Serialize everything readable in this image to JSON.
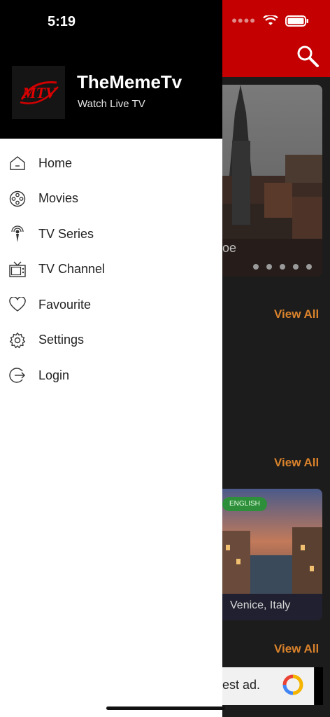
{
  "status_bar": {
    "time": "5:19"
  },
  "drawer": {
    "logo_text": "MTV",
    "app_name": "TheMemeTv",
    "app_subtitle": "Watch Live TV",
    "menu": [
      {
        "label": "Home",
        "icon": "home-icon"
      },
      {
        "label": "Movies",
        "icon": "film-reel-icon"
      },
      {
        "label": "TV Series",
        "icon": "broadcast-icon"
      },
      {
        "label": "TV Channel",
        "icon": "tv-icon"
      },
      {
        "label": "Favourite",
        "icon": "heart-icon"
      },
      {
        "label": "Settings",
        "icon": "gear-icon"
      },
      {
        "label": "Login",
        "icon": "login-icon"
      }
    ]
  },
  "background": {
    "hero_caption_fragment": "oe",
    "view_all": "View All",
    "featured_language": "ENGLISH",
    "featured_caption": "Venice, Italy",
    "ad_text_fragment": "est ad."
  },
  "colors": {
    "brand_red": "#c40000",
    "accent_orange": "#d9822b",
    "drawer_header": "#000000",
    "drawer_body": "#ffffff"
  }
}
